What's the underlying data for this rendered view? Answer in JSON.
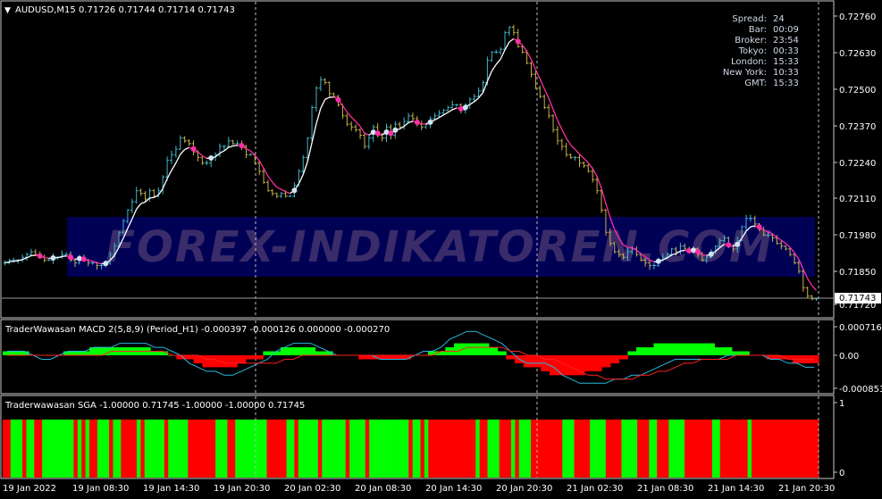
{
  "symbol_header": {
    "arrow": "▼",
    "text": "AUDUSD,M15  0.71726 0.71744 0.71714 0.71743"
  },
  "info_panel": [
    {
      "label": "Spread:",
      "value": "24"
    },
    {
      "label": "Bar:",
      "value": "00:09"
    },
    {
      "label": "Broker:",
      "value": "23:54"
    },
    {
      "label": "Tokyo:",
      "value": "00:33"
    },
    {
      "label": "London:",
      "value": "15:33"
    },
    {
      "label": "New York:",
      "value": "10:33"
    },
    {
      "label": "GMT:",
      "value": "15:33"
    }
  ],
  "watermark": "FOREX-INDIKATOREN.COM",
  "macd_header": "TraderWawasan MACD 2(5,8,9) (Period_H1) -0.000397 -0.000126 0.000000 -0.000270",
  "sga_header": "Traderwawasan SGA -1.00000 0.71745 -1.00000 -1.00000 0.71745",
  "colors": {
    "bull": "#3fb6c9",
    "bear": "#c8b24a",
    "trail_up": "#ffffff",
    "trail_down": "#ff2ea6",
    "dot_up": "#cfe3f2",
    "dot_down": "#ff2ea6",
    "macd_pos": "#00ff00",
    "macd_neg": "#ff0000",
    "macd_line": "#27b8e0",
    "signal_line": "#ff2020",
    "sga_green": "#00ff00",
    "sga_red": "#ff0000",
    "watermark_band": "#000055",
    "watermark_text": "#3a2c6a"
  },
  "x_axis_labels": [
    "19 Jan 2022",
    "19 Jan 08:30",
    "19 Jan 14:30",
    "19 Jan 20:30",
    "20 Jan 02:30",
    "20 Jan 08:30",
    "20 Jan 14:30",
    "20 Jan 20:30",
    "21 Jan 02:30",
    "21 Jan 08:30",
    "21 Jan 14:30",
    "21 Jan 20:30"
  ],
  "chart_data": [
    {
      "type": "bar",
      "title": "AUDUSD,M15",
      "x": [
        "19 Jan 2022",
        "19 Jan 08:30",
        "19 Jan 14:30",
        "19 Jan 20:30",
        "20 Jan 02:30",
        "20 Jan 08:30",
        "20 Jan 14:30",
        "20 Jan 20:30",
        "21 Jan 02:30",
        "21 Jan 08:30",
        "21 Jan 14:30",
        "21 Jan 20:30"
      ],
      "y_ticks": [
        "0.72760",
        "0.72630",
        "0.72500",
        "0.72370",
        "0.72240",
        "0.72110",
        "0.71980",
        "0.71850",
        "0.71720"
      ],
      "ylim": [
        0.717,
        0.7279
      ],
      "current_price_label": "0.71743",
      "current_price": 0.71743,
      "close": [
        0.7187,
        0.7188,
        0.7188,
        0.7188,
        0.7189,
        0.719,
        0.7191,
        0.719,
        0.7189,
        0.7188,
        0.7188,
        0.7189,
        0.7189,
        0.719,
        0.719,
        0.7188,
        0.7187,
        0.7189,
        0.7188,
        0.7187,
        0.7187,
        0.7186,
        0.7186,
        0.7187,
        0.719,
        0.7193,
        0.7198,
        0.7202,
        0.7206,
        0.7209,
        0.7213,
        0.7212,
        0.721,
        0.7213,
        0.7211,
        0.7213,
        0.7218,
        0.7224,
        0.7226,
        0.7228,
        0.7232,
        0.7231,
        0.723,
        0.7227,
        0.7225,
        0.7223,
        0.7223,
        0.7225,
        0.7226,
        0.7229,
        0.7229,
        0.7231,
        0.723,
        0.723,
        0.7229,
        0.7226,
        0.7226,
        0.7223,
        0.722,
        0.7216,
        0.7213,
        0.7212,
        0.7211,
        0.7212,
        0.7211,
        0.7211,
        0.7215,
        0.722,
        0.7225,
        0.7232,
        0.7243,
        0.725,
        0.7253,
        0.7252,
        0.7248,
        0.7247,
        0.7244,
        0.724,
        0.7237,
        0.7236,
        0.7235,
        0.7233,
        0.7229,
        0.7232,
        0.7236,
        0.7233,
        0.7232,
        0.7236,
        0.7233,
        0.7237,
        0.7236,
        0.7238,
        0.724,
        0.7239,
        0.7237,
        0.7236,
        0.7237,
        0.7239,
        0.724,
        0.7241,
        0.7242,
        0.7243,
        0.7244,
        0.7244,
        0.7242,
        0.7244,
        0.7246,
        0.7247,
        0.7249,
        0.7252,
        0.726,
        0.7263,
        0.7263,
        0.7264,
        0.727,
        0.7272,
        0.727,
        0.7265,
        0.7263,
        0.7259,
        0.7255,
        0.725,
        0.7247,
        0.7243,
        0.724,
        0.7235,
        0.7231,
        0.7229,
        0.7226,
        0.7225,
        0.7225,
        0.7223,
        0.7222,
        0.722,
        0.7217,
        0.7213,
        0.7206,
        0.7198,
        0.7194,
        0.7191,
        0.719,
        0.7189,
        0.7191,
        0.7192,
        0.719,
        0.7188,
        0.7187,
        0.7186,
        0.7186,
        0.7188,
        0.7189,
        0.719,
        0.7192,
        0.7191,
        0.7193,
        0.7192,
        0.7191,
        0.7192,
        0.719,
        0.7188,
        0.7189,
        0.7191,
        0.7193,
        0.7195,
        0.7196,
        0.7193,
        0.7192,
        0.7195,
        0.72,
        0.7203,
        0.7203,
        0.7201,
        0.7199,
        0.7197,
        0.7197,
        0.7196,
        0.7194,
        0.7193,
        0.7192,
        0.719,
        0.7187,
        0.7184,
        0.7178,
        0.7175,
        0.7174,
        0.7174
      ]
    },
    {
      "type": "bar",
      "title": "TraderWawasan MACD 2(5,8,9) (Period_H1)",
      "y_ticks": [
        "0.000716",
        "0.00",
        "-0.000853"
      ],
      "ylim": [
        -0.000853,
        0.000716
      ],
      "macd_line": [
        0.0001,
        0.0001,
        0.0001,
        0.0,
        -0.0001,
        -0.0001,
        0.0,
        0.0001,
        0.0001,
        0.0001,
        0.0002,
        0.0002,
        0.0002,
        0.0003,
        0.0003,
        0.0003,
        0.0003,
        0.0002,
        0.0002,
        0.0001,
        0.0,
        -0.0002,
        -0.0003,
        -0.0004,
        -0.0004,
        -0.0005,
        -0.0005,
        -0.0004,
        -0.0003,
        -0.0002,
        -0.0001,
        0.0001,
        0.0002,
        0.0003,
        0.0003,
        0.0003,
        0.0002,
        0.0001,
        0.0,
        0.0,
        0.0,
        0.0,
        0.0,
        -0.0001,
        -0.0001,
        -0.0001,
        -0.0001,
        0.0,
        0.0001,
        0.0001,
        0.0002,
        0.0004,
        0.0005,
        0.0006,
        0.0006,
        0.0005,
        0.0004,
        0.0003,
        0.0001,
        -0.0001,
        -0.0002,
        -0.0002,
        -0.0002,
        -0.0003,
        -0.0005,
        -0.0006,
        -0.0007,
        -0.0007,
        -0.0007,
        -0.0007,
        -0.0006,
        -0.0006,
        -0.0005,
        -0.0005,
        -0.0004,
        -0.0003,
        -0.0002,
        -0.0001,
        -0.0001,
        -0.0001,
        -0.0001,
        -0.0001,
        -0.0001,
        0.0,
        0.0,
        0.0,
        0.0,
        0.0,
        -0.0001,
        -0.0001,
        -0.0002,
        -0.0002,
        -0.0003,
        -0.0003
      ],
      "signal_line": [
        0.0,
        0.0,
        0.0,
        0.0,
        0.0,
        0.0,
        0.0,
        0.0,
        0.0,
        0.0,
        0.0,
        0.0,
        0.0001,
        0.0001,
        0.0001,
        0.0001,
        0.0001,
        0.0001,
        0.0001,
        0.0,
        0.0,
        0.0,
        0.0,
        -0.0001,
        -0.0001,
        -0.0002,
        -0.0002,
        -0.0002,
        -0.0002,
        -0.0002,
        -0.0002,
        -0.0002,
        -0.0001,
        -0.0001,
        0.0,
        0.0,
        0.0,
        0.0,
        0.0,
        0.0,
        0.0,
        0.0,
        0.0,
        0.0,
        0.0,
        0.0,
        0.0,
        0.0,
        0.0,
        0.0,
        0.0001,
        0.0001,
        0.0001,
        0.0002,
        0.0002,
        0.0002,
        0.0002,
        0.0002,
        0.0001,
        0.0001,
        0.0,
        0.0,
        -0.0001,
        -0.0001,
        -0.0002,
        -0.0003,
        -0.0004,
        -0.0005,
        -0.0005,
        -0.0006,
        -0.0006,
        -0.0006,
        -0.0006,
        -0.0005,
        -0.0005,
        -0.0004,
        -0.0004,
        -0.0003,
        -0.0002,
        -0.0002,
        -0.0001,
        -0.0001,
        -0.0001,
        -0.0001,
        0.0,
        0.0,
        0.0,
        0.0,
        0.0,
        0.0,
        -0.0001,
        -0.0001,
        -0.0001,
        -0.0001
      ],
      "histogram": [
        0.0001,
        0.0001,
        0.0001,
        0.0,
        0.0,
        0.0,
        0.0,
        0.0001,
        0.0001,
        0.0001,
        0.0002,
        0.0002,
        0.0002,
        0.0002,
        0.0002,
        0.0002,
        0.0002,
        0.0001,
        0.0001,
        0.0,
        -0.0001,
        -0.0001,
        -0.0002,
        -0.0003,
        -0.0003,
        -0.0003,
        -0.0003,
        -0.0002,
        -0.0001,
        -0.0001,
        0.0001,
        0.0001,
        0.0002,
        0.0002,
        0.0002,
        0.0002,
        0.0001,
        0.0001,
        0.0,
        0.0,
        0.0,
        -0.0001,
        -0.0001,
        -0.0001,
        -0.0001,
        -0.0001,
        -0.0001,
        0.0,
        0.0,
        0.0001,
        0.0001,
        0.0002,
        0.0003,
        0.0003,
        0.0003,
        0.0003,
        0.0002,
        0.0001,
        -0.0001,
        -0.0002,
        -0.0003,
        -0.0003,
        -0.0004,
        -0.0005,
        -0.0005,
        -0.0005,
        -0.0005,
        -0.0004,
        -0.0004,
        -0.0003,
        -0.0002,
        -0.0001,
        0.0001,
        0.0002,
        0.0002,
        0.0003,
        0.0003,
        0.0003,
        0.0003,
        0.0003,
        0.0003,
        0.0003,
        0.0002,
        0.0002,
        0.0001,
        0.0001,
        0.0,
        0.0,
        -0.0001,
        -0.0001,
        -0.0001,
        -0.0002,
        -0.0002,
        -0.0002
      ]
    },
    {
      "type": "bar",
      "title": "Traderwawasan SGA",
      "y_ticks": [
        "1",
        "0"
      ],
      "ylim": [
        0,
        1
      ],
      "signal": [
        -1,
        -1,
        1,
        1,
        1,
        -1,
        1,
        1,
        -1,
        -1,
        1,
        1,
        1,
        1,
        1,
        1,
        1,
        1,
        -1,
        1,
        -1,
        1,
        -1,
        -1,
        1,
        1,
        1,
        -1,
        1,
        1,
        -1,
        -1,
        -1,
        -1,
        1,
        -1,
        1,
        1,
        1,
        1,
        1,
        -1,
        1,
        1,
        1,
        1,
        1,
        -1,
        -1,
        -1,
        -1,
        -1,
        -1,
        -1,
        1,
        1,
        1,
        -1,
        -1,
        1,
        1,
        1,
        1,
        1,
        1,
        1,
        1,
        -1,
        -1,
        -1,
        -1,
        -1,
        1,
        1,
        -1,
        1,
        1,
        1,
        1,
        1,
        -1,
        1,
        1,
        1,
        1,
        1,
        1,
        -1,
        1,
        1,
        1,
        1,
        -1,
        1,
        1,
        1,
        1,
        1,
        1,
        1,
        1,
        1,
        1,
        -1,
        1,
        1,
        -1,
        1,
        -1,
        -1,
        -1,
        -1,
        -1,
        -1,
        -1,
        -1,
        -1,
        -1,
        -1,
        -1,
        1,
        -1,
        -1,
        1,
        1,
        1,
        -1,
        -1,
        -1,
        1,
        -1,
        1,
        1,
        1,
        -1,
        -1,
        -1,
        -1,
        -1,
        -1,
        -1,
        -1,
        1,
        1,
        1,
        -1,
        -1,
        -1,
        -1,
        1,
        1,
        1,
        1,
        -1,
        -1,
        -1,
        -1,
        1,
        1,
        1,
        1,
        -1,
        -1,
        -1,
        1,
        1,
        -1,
        -1,
        -1,
        1,
        1,
        1,
        1,
        -1,
        -1,
        -1,
        -1,
        -1,
        -1,
        -1,
        1,
        1,
        -1,
        -1,
        -1,
        -1,
        -1,
        -1,
        -1,
        1,
        -1,
        -1,
        -1,
        -1,
        -1,
        -1,
        -1,
        -1,
        -1,
        -1,
        -1,
        -1,
        -1,
        -1,
        -1,
        -1,
        -1
      ]
    }
  ]
}
